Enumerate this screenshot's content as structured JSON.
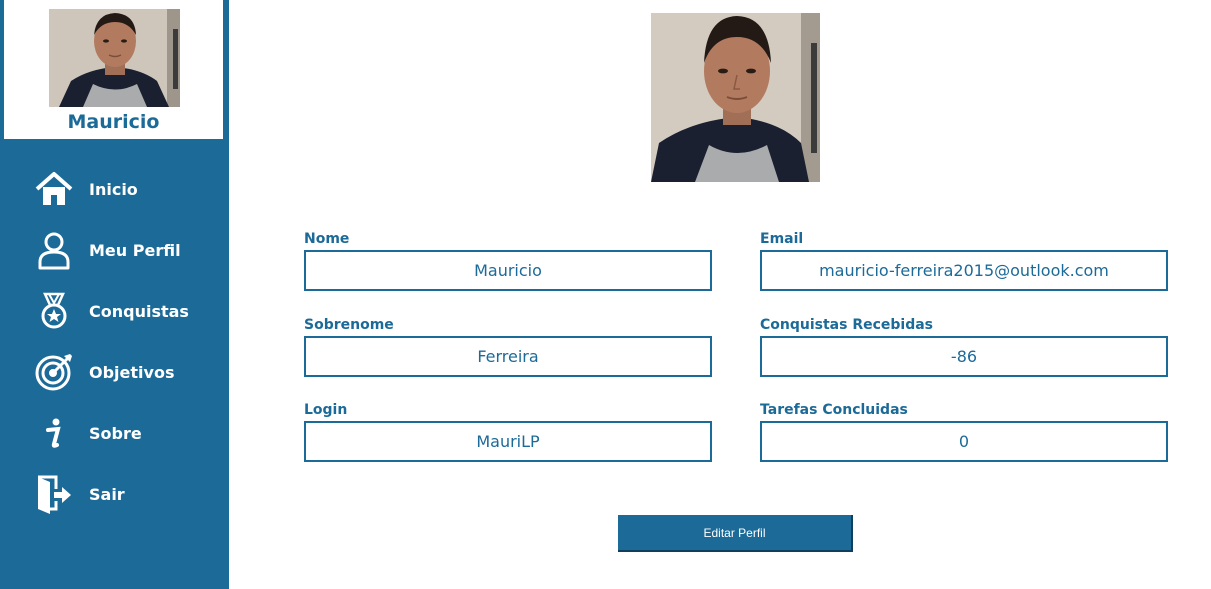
{
  "sidebar": {
    "username": "Mauricio",
    "items": [
      {
        "label": "Inicio",
        "icon": "home-icon"
      },
      {
        "label": "Meu Perfil",
        "icon": "user-icon"
      },
      {
        "label": "Conquistas",
        "icon": "medal-icon"
      },
      {
        "label": "Objetivos",
        "icon": "target-icon"
      },
      {
        "label": "Sobre",
        "icon": "info-icon"
      },
      {
        "label": "Sair",
        "icon": "exit-door-icon"
      }
    ]
  },
  "profile": {
    "fields": {
      "nome": {
        "label": "Nome",
        "value": "Mauricio"
      },
      "sobrenome": {
        "label": "Sobrenome",
        "value": "Ferreira"
      },
      "login": {
        "label": "Login",
        "value": "MauriLP"
      },
      "email": {
        "label": "Email",
        "value": "mauricio-ferreira2015@outlook.com"
      },
      "conquistas": {
        "label": "Conquistas Recebidas",
        "value": "-86"
      },
      "tarefas": {
        "label": "Tarefas Concluidas",
        "value": "0"
      }
    },
    "edit_button_label": "Editar Perfil"
  },
  "colors": {
    "brand": "#1c6a98",
    "background": "#ffffff"
  }
}
